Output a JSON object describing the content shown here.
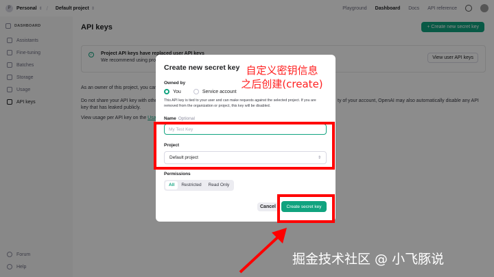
{
  "topbar": {
    "org_initial": "P",
    "org_name": "Personal",
    "project_name": "Default project",
    "nav": [
      "Playground",
      "Dashboard",
      "Docs",
      "API reference"
    ],
    "active_nav": "Dashboard"
  },
  "sidebar": {
    "header": "DASHBOARD",
    "items": [
      {
        "label": "Assistants",
        "icon": "assistant-icon"
      },
      {
        "label": "Fine-tuning",
        "icon": "tune-icon"
      },
      {
        "label": "Batches",
        "icon": "batch-icon"
      },
      {
        "label": "Storage",
        "icon": "storage-icon"
      },
      {
        "label": "Usage",
        "icon": "usage-icon"
      },
      {
        "label": "API keys",
        "icon": "key-icon",
        "active": true
      }
    ],
    "bottom": [
      {
        "label": "Forum",
        "icon": "forum-icon"
      },
      {
        "label": "Help",
        "icon": "help-icon"
      }
    ]
  },
  "main": {
    "title": "API keys",
    "create_button": "+ Create new secret key",
    "banner_title": "Project API keys have replaced user API keys",
    "banner_sub": "We recommend using proj",
    "view_user_keys": "View user API keys",
    "p1": "As an owner of this project, you can",
    "p2a": "Do not share your API key with othe",
    "p2b": "key that has leaked publicly.",
    "p2_right": "ty of your account, OpenAI may also automatically disable any API",
    "p3": "View usage per API key on the ",
    "p3_link": "Usa"
  },
  "modal": {
    "title": "Create new secret key",
    "owned_by_label": "Owned by",
    "owner_options": [
      "You",
      "Service account"
    ],
    "owner_selected": "You",
    "description": "This API key is tied to your user and can make requests against the selected project. If you are removed from the organization or project, this key will be disabled.",
    "name_label": "Name",
    "name_optional": "Optional",
    "name_placeholder": "My Test Key",
    "project_label": "Project",
    "project_value": "Default project",
    "permissions_label": "Permissions",
    "permissions": [
      "All",
      "Restricted",
      "Read Only"
    ],
    "permissions_selected": "All",
    "cancel": "Cancel",
    "create": "Create secret key"
  },
  "annotation": {
    "line1": "自定义密钥信息",
    "line2": "之后创建(create)"
  },
  "watermark": "掘金技术社区 @ 小飞豚说",
  "colors": {
    "accent": "#10a37f",
    "annotation_red": "#ff0000"
  }
}
